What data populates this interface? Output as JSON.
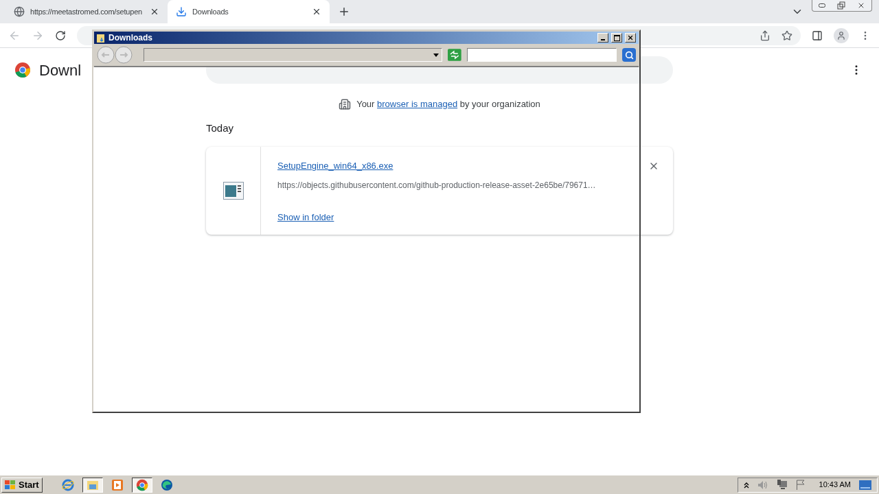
{
  "browser": {
    "tabs": [
      {
        "title": "https://meetastromed.com/setupen",
        "kind": "web",
        "selected": false
      },
      {
        "title": "Downloads",
        "kind": "download",
        "selected": true
      }
    ]
  },
  "page": {
    "heading": "Downl",
    "managed_notice": {
      "before": "Your",
      "link": "browser is managed",
      "after": "by your organization"
    },
    "section": "Today",
    "downloads": [
      {
        "file_name": "SetupEngine_win64_x86.exe",
        "url": "https://objects.githubusercontent.com/github-production-release-asset-2e65be/79671…",
        "action": "Show in folder"
      }
    ]
  },
  "explorer_window": {
    "title": "Downloads"
  },
  "taskbar": {
    "start": "Start",
    "apps": [
      {
        "kind": "ie",
        "selected": false
      },
      {
        "kind": "explorer",
        "selected": true
      },
      {
        "kind": "media",
        "selected": false
      },
      {
        "kind": "chrome",
        "selected": true
      },
      {
        "kind": "edge",
        "selected": false
      }
    ],
    "clock": "10:43 AM"
  }
}
